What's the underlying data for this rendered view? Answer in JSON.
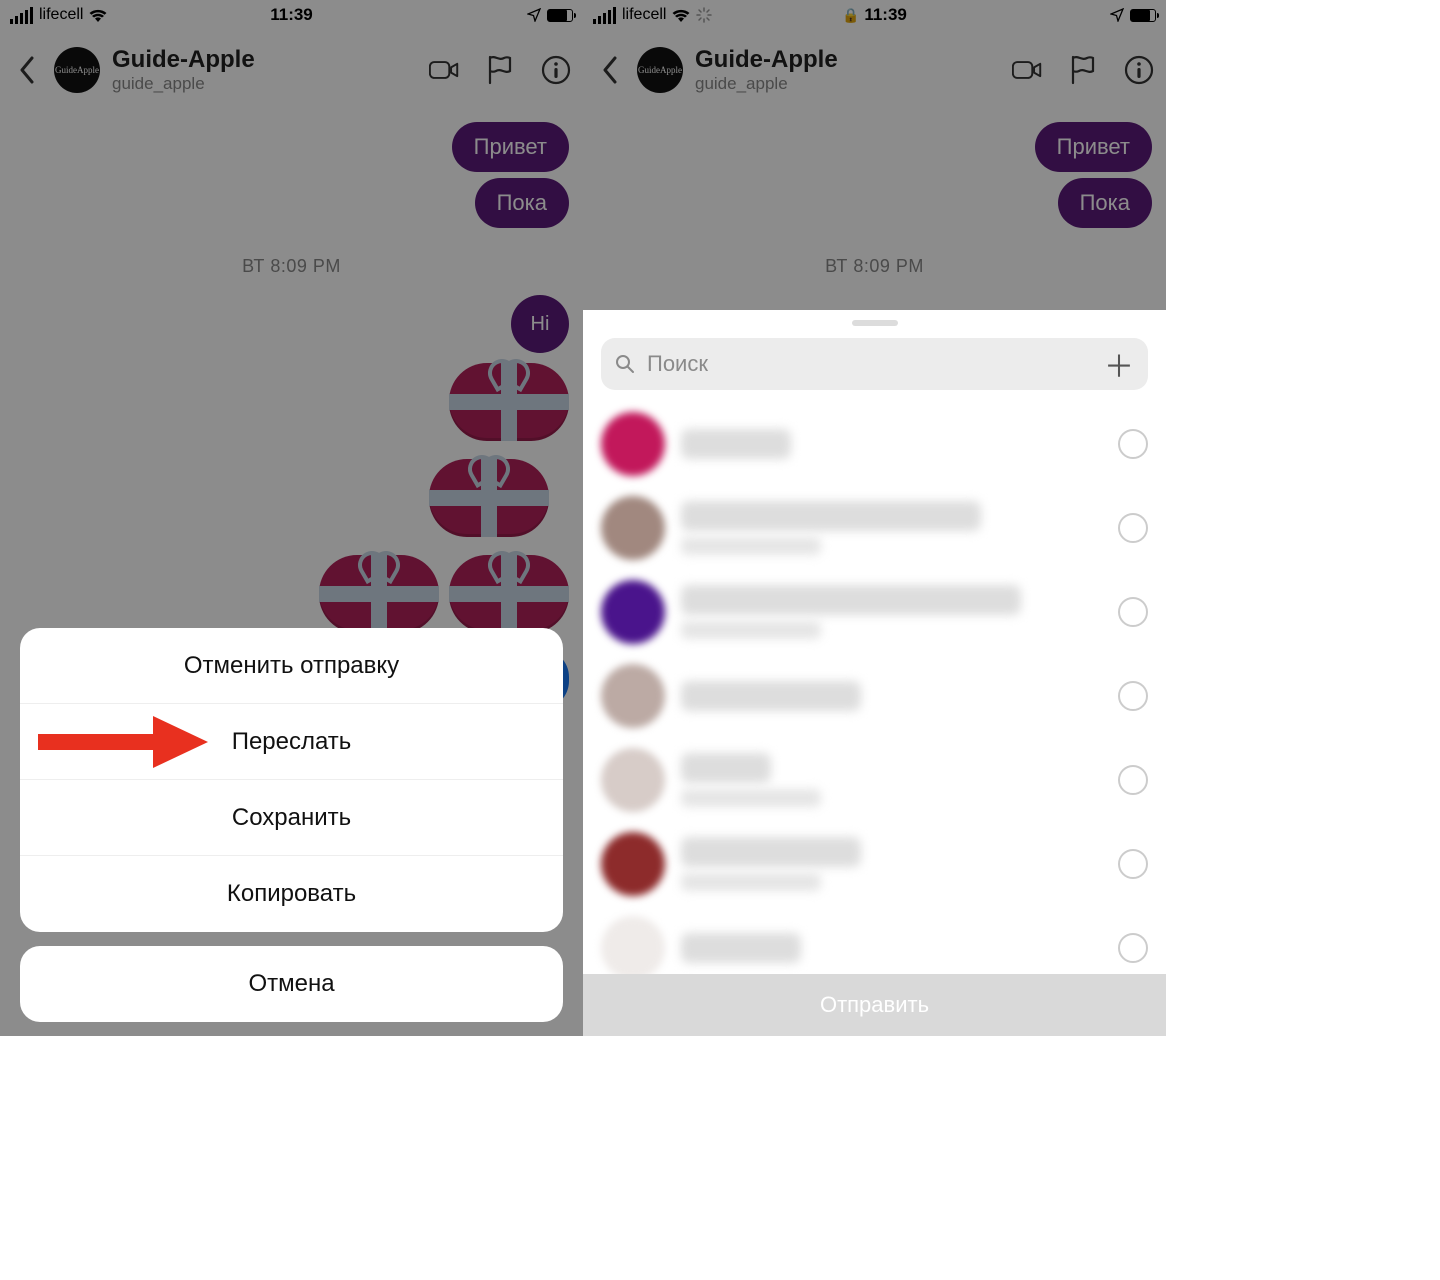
{
  "status": {
    "carrier": "lifecell",
    "time": "11:39"
  },
  "header": {
    "title": "Guide-Apple",
    "subtitle": "guide_apple"
  },
  "messages": {
    "m1": "Привет",
    "m2": "Пока",
    "timestamp": "ВТ 8:09 PM",
    "m3": "Hi"
  },
  "actionsheet": {
    "unsend": "Отменить отправку",
    "forward": "Переслать",
    "save": "Сохранить",
    "copy": "Копировать",
    "cancel": "Отмена"
  },
  "share": {
    "search_placeholder": "Поиск",
    "send": "Отправить"
  }
}
